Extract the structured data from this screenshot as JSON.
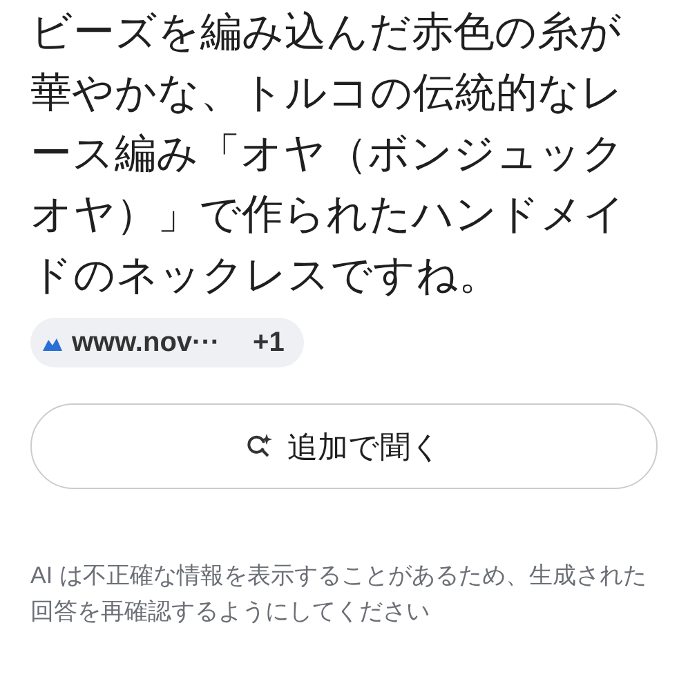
{
  "answer": "ビーズを編み込んだ赤色の糸が華やかな、トルコの伝統的なレース編み「オヤ（ボンジュックオヤ）」で作られたハンドメイドのネックレスですね。",
  "source_chip": {
    "label": "www.nov···",
    "count": "+1"
  },
  "ask_more_button": {
    "label": "追加で聞く"
  },
  "disclaimer": "AI は不正確な情報を表示することがあるため、生成された回答を再確認するようにしてください"
}
